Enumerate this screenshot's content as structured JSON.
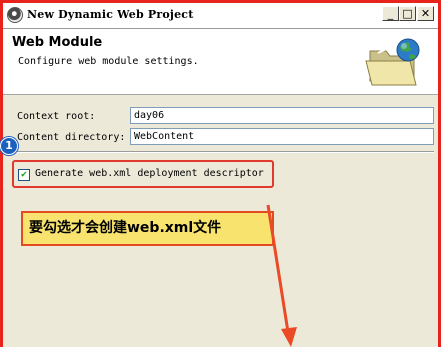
{
  "window": {
    "title": "New Dynamic Web Project",
    "minimize_glyph": "_",
    "maximize_glyph": "□",
    "close_glyph": "✕"
  },
  "header": {
    "title": "Web Module",
    "description": "Configure web module settings."
  },
  "form": {
    "context_root_label": "Context root:",
    "context_root_value": "day06",
    "content_dir_label": "Content directory:",
    "content_dir_value": "WebContent",
    "generate_label": "Generate web.xml deployment descriptor",
    "generate_checked": true,
    "check_glyph": "✔"
  },
  "annotations": {
    "step_number": "1",
    "note_text": "要勾选才会创建web.xml文件",
    "highlight_color": "#e8231b",
    "note_bg": "#f7e36d",
    "badge_color": "#1b5fbf"
  },
  "icons": [
    "eclipse-app-icon",
    "web-folder-globe-icon"
  ]
}
